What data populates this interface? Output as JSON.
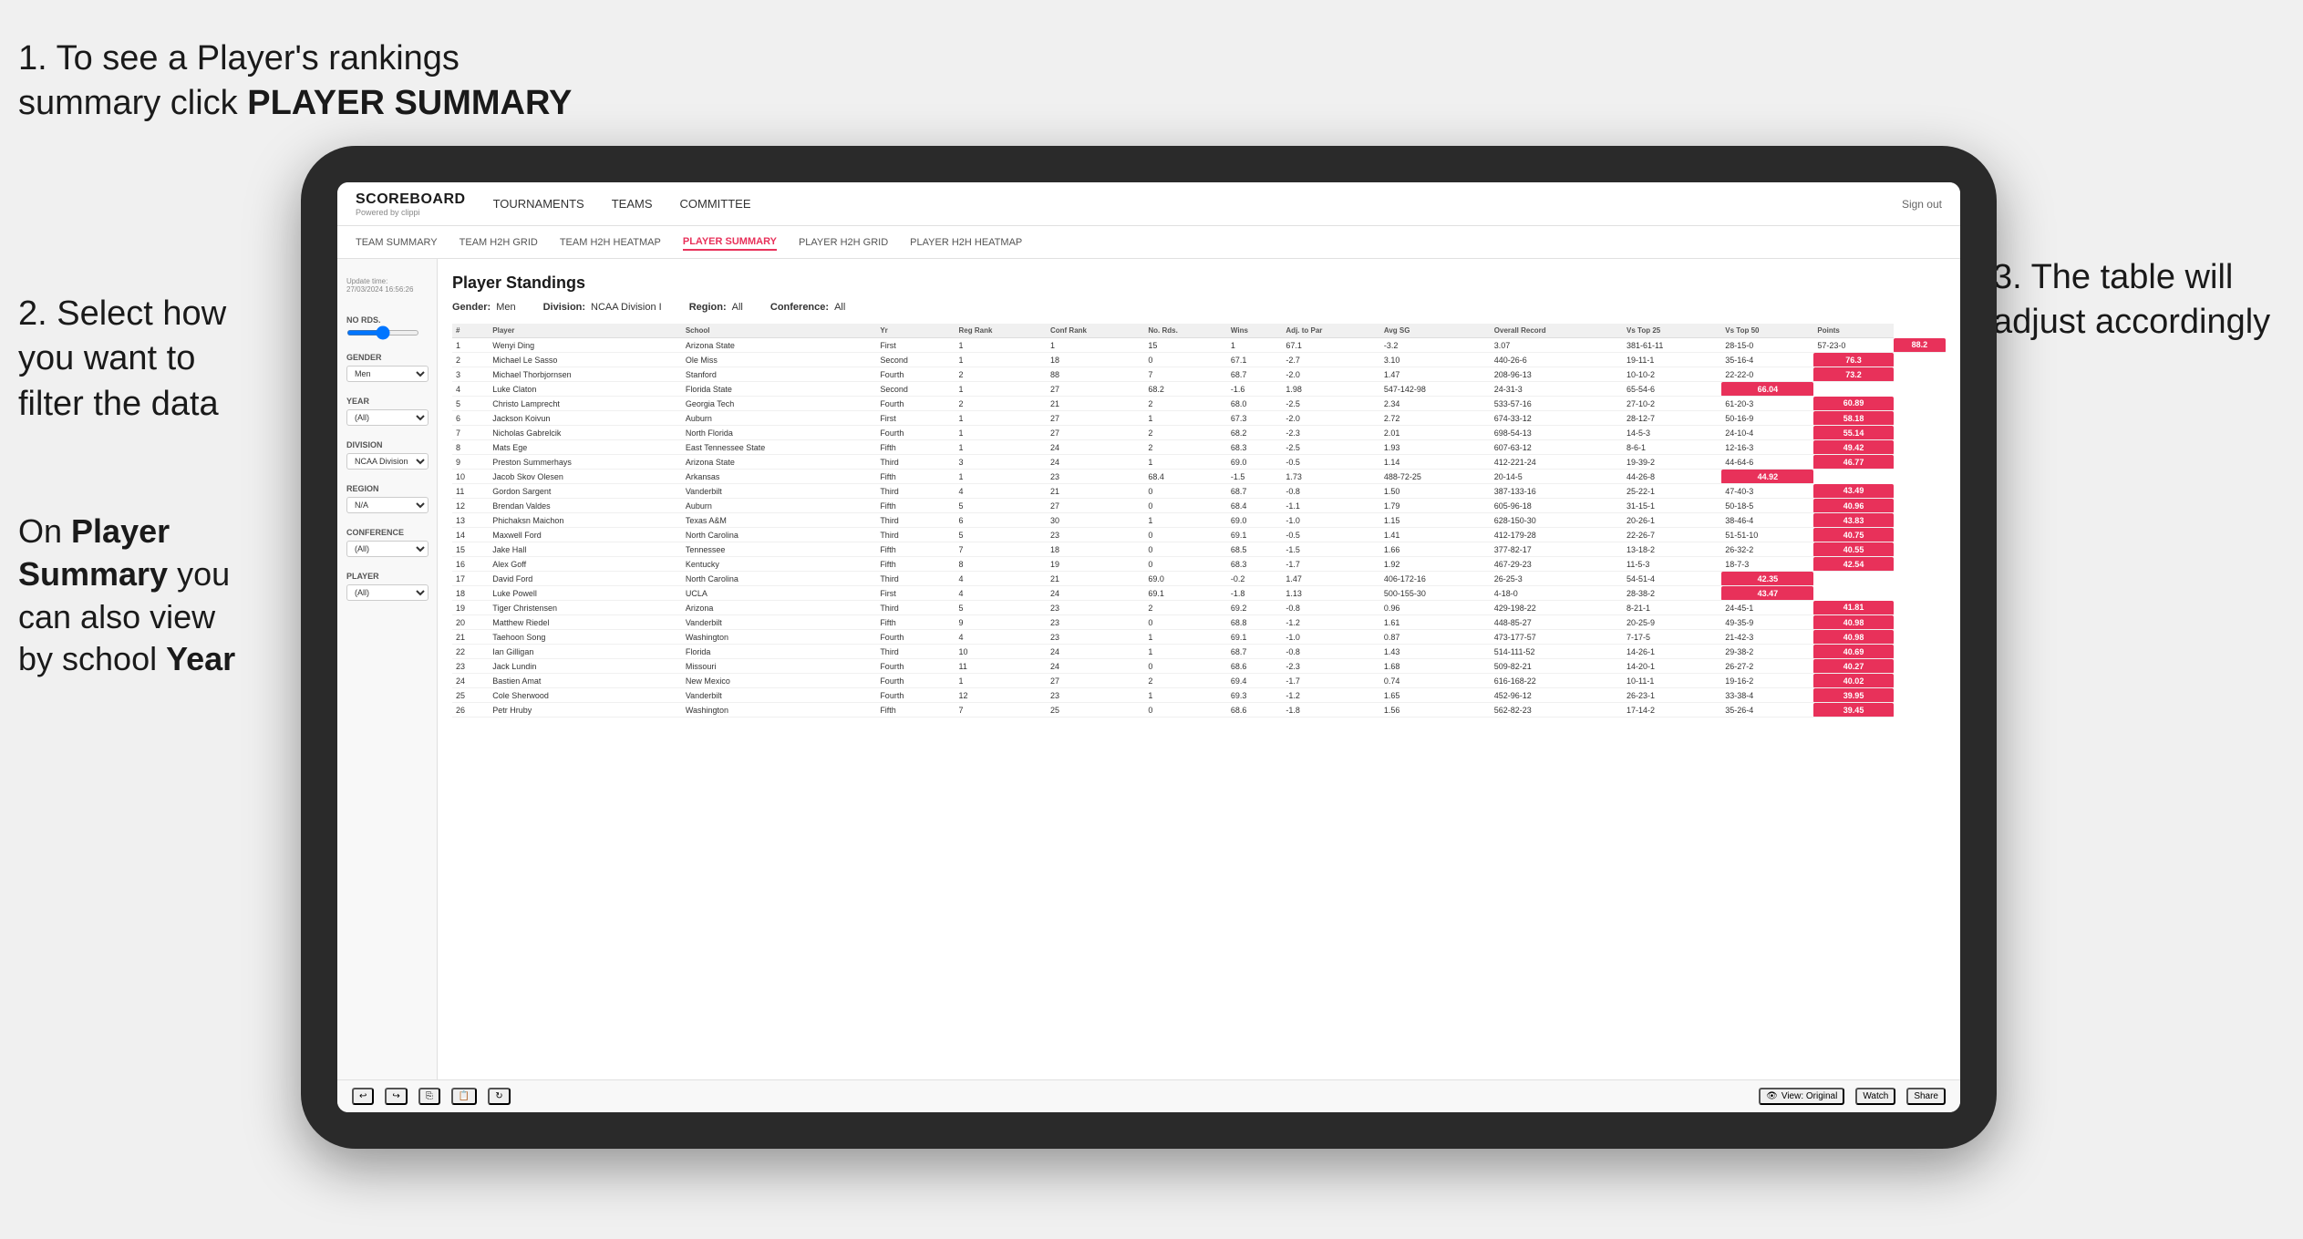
{
  "annotations": {
    "text1_line1": "1. To see a Player's rankings",
    "text1_line2": "summary click ",
    "text1_bold": "PLAYER SUMMARY",
    "text2_line1": "2. Select how",
    "text2_line2": "you want to",
    "text2_line3": "filter the data",
    "text3_line1": "3. The table will",
    "text3_line2": "adjust accordingly",
    "text4_line1": "On ",
    "text4_bold1": "Player",
    "text4_line2": "Summary",
    "text4_bold2": " you",
    "text4_line3": "can also view",
    "text4_line4": "by school ",
    "text4_bold3": "Year"
  },
  "nav": {
    "logo": "SCOREBOARD",
    "logo_sub": "Powered by clippi",
    "links": [
      "TOURNAMENTS",
      "TEAMS",
      "COMMITTEE"
    ],
    "sign_out": "Sign out"
  },
  "sub_nav": {
    "links": [
      "TEAM SUMMARY",
      "TEAM H2H GRID",
      "TEAM H2H HEATMAP",
      "PLAYER SUMMARY",
      "PLAYER H2H GRID",
      "PLAYER H2H HEATMAP"
    ]
  },
  "sidebar": {
    "no_rds_label": "No Rds.",
    "gender_label": "Gender",
    "gender_value": "Men",
    "year_label": "Year",
    "year_value": "(All)",
    "division_label": "Division",
    "division_value": "NCAA Division I",
    "region_label": "Region",
    "region_value": "N/A",
    "conference_label": "Conference",
    "conference_value": "(All)",
    "player_label": "Player",
    "player_value": "(All)"
  },
  "table": {
    "update_time": "Update time:",
    "update_date": "27/03/2024 16:56:26",
    "title": "Player Standings",
    "gender_label": "Gender:",
    "gender_val": "Men",
    "division_label": "Division:",
    "division_val": "NCAA Division I",
    "region_label": "Region:",
    "region_val": "All",
    "conference_label": "Conference:",
    "conference_val": "All",
    "columns": [
      "#",
      "Player",
      "School",
      "Yr",
      "Reg Rank",
      "Conf Rank",
      "No. Rds.",
      "Wins",
      "Adj. to Par",
      "Avg SG",
      "Overall Record",
      "Vs Top 25",
      "Vs Top 50",
      "Points"
    ],
    "rows": [
      [
        "1",
        "Wenyi Ding",
        "Arizona State",
        "First",
        "1",
        "1",
        "15",
        "1",
        "67.1",
        "-3.2",
        "3.07",
        "381-61-11",
        "28-15-0",
        "57-23-0",
        "88.2"
      ],
      [
        "2",
        "Michael Le Sasso",
        "Ole Miss",
        "Second",
        "1",
        "18",
        "0",
        "67.1",
        "-2.7",
        "3.10",
        "440-26-6",
        "19-11-1",
        "35-16-4",
        "76.3"
      ],
      [
        "3",
        "Michael Thorbjornsen",
        "Stanford",
        "Fourth",
        "2",
        "88",
        "7",
        "68.7",
        "-2.0",
        "1.47",
        "208-96-13",
        "10-10-2",
        "22-22-0",
        "73.2"
      ],
      [
        "4",
        "Luke Claton",
        "Florida State",
        "Second",
        "1",
        "27",
        "68.2",
        "-1.6",
        "1.98",
        "547-142-98",
        "24-31-3",
        "65-54-6",
        "66.04"
      ],
      [
        "5",
        "Christo Lamprecht",
        "Georgia Tech",
        "Fourth",
        "2",
        "21",
        "2",
        "68.0",
        "-2.5",
        "2.34",
        "533-57-16",
        "27-10-2",
        "61-20-3",
        "60.89"
      ],
      [
        "6",
        "Jackson Koivun",
        "Auburn",
        "First",
        "1",
        "27",
        "1",
        "67.3",
        "-2.0",
        "2.72",
        "674-33-12",
        "28-12-7",
        "50-16-9",
        "58.18"
      ],
      [
        "7",
        "Nicholas Gabrelcik",
        "North Florida",
        "Fourth",
        "1",
        "27",
        "2",
        "68.2",
        "-2.3",
        "2.01",
        "698-54-13",
        "14-5-3",
        "24-10-4",
        "55.14"
      ],
      [
        "8",
        "Mats Ege",
        "East Tennessee State",
        "Fifth",
        "1",
        "24",
        "2",
        "68.3",
        "-2.5",
        "1.93",
        "607-63-12",
        "8-6-1",
        "12-16-3",
        "49.42"
      ],
      [
        "9",
        "Preston Summerhays",
        "Arizona State",
        "Third",
        "3",
        "24",
        "1",
        "69.0",
        "-0.5",
        "1.14",
        "412-221-24",
        "19-39-2",
        "44-64-6",
        "46.77"
      ],
      [
        "10",
        "Jacob Skov Olesen",
        "Arkansas",
        "Fifth",
        "1",
        "23",
        "68.4",
        "-1.5",
        "1.73",
        "488-72-25",
        "20-14-5",
        "44-26-8",
        "44.92"
      ],
      [
        "11",
        "Gordon Sargent",
        "Vanderbilt",
        "Third",
        "4",
        "21",
        "0",
        "68.7",
        "-0.8",
        "1.50",
        "387-133-16",
        "25-22-1",
        "47-40-3",
        "43.49"
      ],
      [
        "12",
        "Brendan Valdes",
        "Auburn",
        "Fifth",
        "5",
        "27",
        "0",
        "68.4",
        "-1.1",
        "1.79",
        "605-96-18",
        "31-15-1",
        "50-18-5",
        "40.96"
      ],
      [
        "13",
        "Phichaksn Maichon",
        "Texas A&M",
        "Third",
        "6",
        "30",
        "1",
        "69.0",
        "-1.0",
        "1.15",
        "628-150-30",
        "20-26-1",
        "38-46-4",
        "43.83"
      ],
      [
        "14",
        "Maxwell Ford",
        "North Carolina",
        "Third",
        "5",
        "23",
        "0",
        "69.1",
        "-0.5",
        "1.41",
        "412-179-28",
        "22-26-7",
        "51-51-10",
        "40.75"
      ],
      [
        "15",
        "Jake Hall",
        "Tennessee",
        "Fifth",
        "7",
        "18",
        "0",
        "68.5",
        "-1.5",
        "1.66",
        "377-82-17",
        "13-18-2",
        "26-32-2",
        "40.55"
      ],
      [
        "16",
        "Alex Goff",
        "Kentucky",
        "Fifth",
        "8",
        "19",
        "0",
        "68.3",
        "-1.7",
        "1.92",
        "467-29-23",
        "11-5-3",
        "18-7-3",
        "42.54"
      ],
      [
        "17",
        "David Ford",
        "North Carolina",
        "Third",
        "4",
        "21",
        "69.0",
        "-0.2",
        "1.47",
        "406-172-16",
        "26-25-3",
        "54-51-4",
        "42.35"
      ],
      [
        "18",
        "Luke Powell",
        "UCLA",
        "First",
        "4",
        "24",
        "69.1",
        "-1.8",
        "1.13",
        "500-155-30",
        "4-18-0",
        "28-38-2",
        "43.47"
      ],
      [
        "19",
        "Tiger Christensen",
        "Arizona",
        "Third",
        "5",
        "23",
        "2",
        "69.2",
        "-0.8",
        "0.96",
        "429-198-22",
        "8-21-1",
        "24-45-1",
        "41.81"
      ],
      [
        "20",
        "Matthew Riedel",
        "Vanderbilt",
        "Fifth",
        "9",
        "23",
        "0",
        "68.8",
        "-1.2",
        "1.61",
        "448-85-27",
        "20-25-9",
        "49-35-9",
        "40.98"
      ],
      [
        "21",
        "Taehoon Song",
        "Washington",
        "Fourth",
        "4",
        "23",
        "1",
        "69.1",
        "-1.0",
        "0.87",
        "473-177-57",
        "7-17-5",
        "21-42-3",
        "40.98"
      ],
      [
        "22",
        "Ian Gilligan",
        "Florida",
        "Third",
        "10",
        "24",
        "1",
        "68.7",
        "-0.8",
        "1.43",
        "514-111-52",
        "14-26-1",
        "29-38-2",
        "40.69"
      ],
      [
        "23",
        "Jack Lundin",
        "Missouri",
        "Fourth",
        "11",
        "24",
        "0",
        "68.6",
        "-2.3",
        "1.68",
        "509-82-21",
        "14-20-1",
        "26-27-2",
        "40.27"
      ],
      [
        "24",
        "Bastien Amat",
        "New Mexico",
        "Fourth",
        "1",
        "27",
        "2",
        "69.4",
        "-1.7",
        "0.74",
        "616-168-22",
        "10-11-1",
        "19-16-2",
        "40.02"
      ],
      [
        "25",
        "Cole Sherwood",
        "Vanderbilt",
        "Fourth",
        "12",
        "23",
        "1",
        "69.3",
        "-1.2",
        "1.65",
        "452-96-12",
        "26-23-1",
        "33-38-4",
        "39.95"
      ],
      [
        "26",
        "Petr Hruby",
        "Washington",
        "Fifth",
        "7",
        "25",
        "0",
        "68.6",
        "-1.8",
        "1.56",
        "562-82-23",
        "17-14-2",
        "35-26-4",
        "39.45"
      ]
    ]
  },
  "toolbar": {
    "view_label": "View: Original",
    "watch_label": "Watch",
    "share_label": "Share"
  }
}
